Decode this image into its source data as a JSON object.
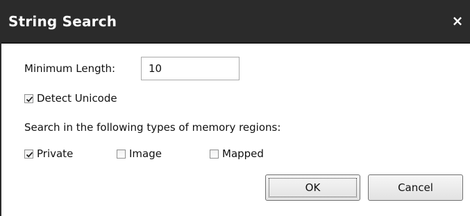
{
  "dialog": {
    "title": "String Search",
    "close_glyph": "×"
  },
  "min_length": {
    "label": "Minimum Length:",
    "value": "10"
  },
  "detect_unicode": {
    "label": "Detect Unicode",
    "checked": true
  },
  "regions": {
    "heading": "Search in the following types of memory regions:",
    "options": [
      {
        "label": "Private",
        "checked": true
      },
      {
        "label": "Image",
        "checked": false
      },
      {
        "label": "Mapped",
        "checked": false
      }
    ]
  },
  "buttons": {
    "ok": "OK",
    "cancel": "Cancel"
  },
  "colors": {
    "titlebar": "#2b2b2b",
    "title_text": "#ffffff",
    "checkmark": "#1f1f1f"
  },
  "icons": {
    "close": "close-icon",
    "check": "checkmark-icon"
  }
}
